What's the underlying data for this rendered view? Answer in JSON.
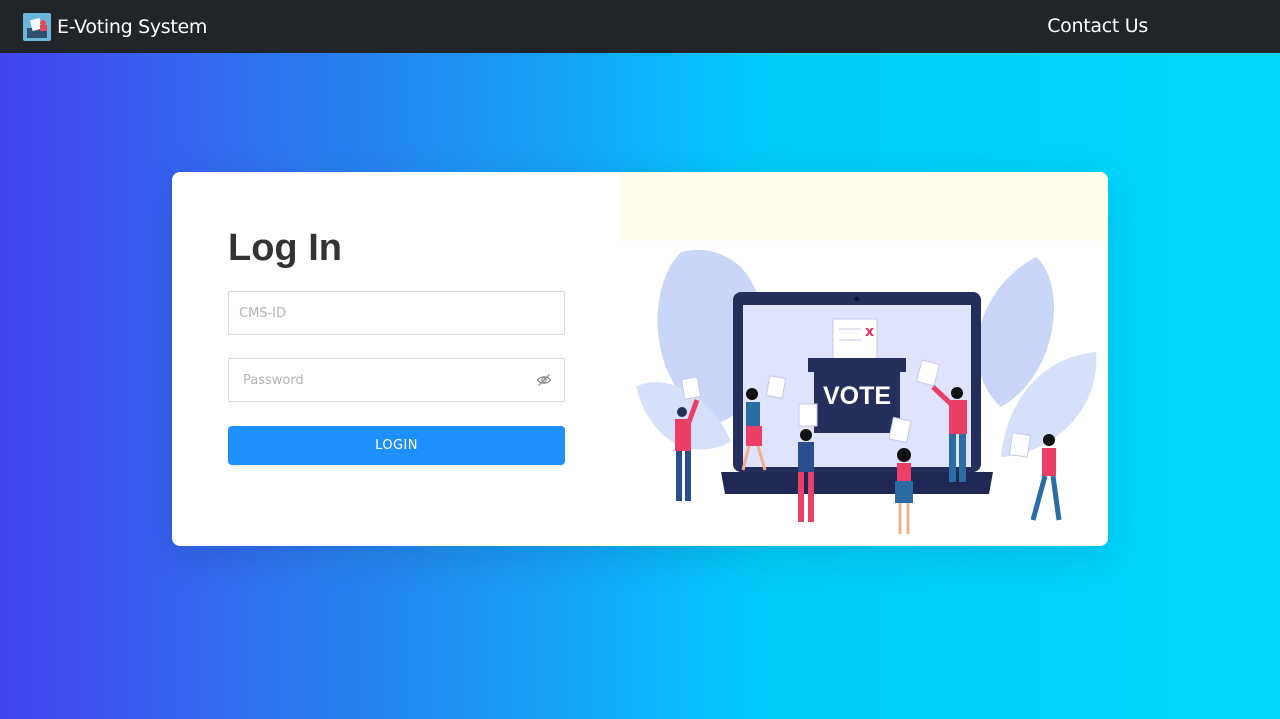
{
  "navbar": {
    "brand_text": "E-Voting System",
    "brand_icon": "ballot-logo-icon",
    "contact_label": "Contact Us"
  },
  "login": {
    "title": "Log In",
    "cms_placeholder": "CMS-ID",
    "password_placeholder": "Password",
    "password_toggle_icon": "eye-slash-icon",
    "button_label": "LOGIN"
  },
  "illustration": {
    "box_label": "VOTE"
  },
  "colors": {
    "navbar_bg": "#212429",
    "gradient_start": "#4343ef",
    "gradient_end": "#00d8ff",
    "primary_button": "#1e8fff",
    "card_bg": "#ffffff"
  }
}
